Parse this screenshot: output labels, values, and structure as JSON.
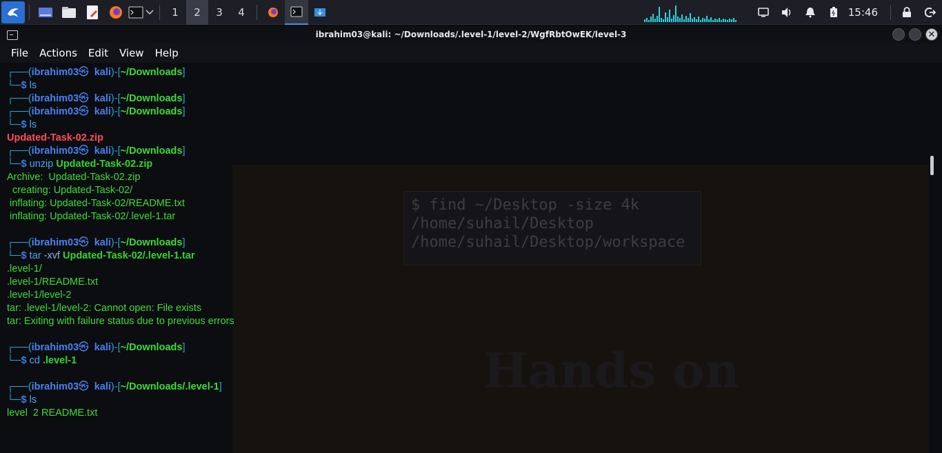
{
  "panel": {
    "workspaces": [
      "1",
      "2",
      "3",
      "4"
    ],
    "active_workspace": "2",
    "clock": "15:46",
    "icons": [
      "kali-menu-icon",
      "desktop-icon",
      "file-manager-icon",
      "text-editor-icon",
      "firefox-icon",
      "terminal-icon",
      "chevron-down-icon"
    ],
    "tray_icons": [
      "screen-icon",
      "volume-icon",
      "bell-icon",
      "battery-icon",
      "lock-icon",
      "logout-icon"
    ]
  },
  "window": {
    "title": "ibrahim03@kali: ~/Downloads/.level-1/level-2/WgfRbtOwEK/level-3",
    "menu": [
      "File",
      "Actions",
      "Edit",
      "View",
      "Help"
    ]
  },
  "prompt": {
    "user": "ibrahim03",
    "host": "kali",
    "skull": "㉿"
  },
  "terminal": {
    "blocks": [
      {
        "dir": "~/Downloads",
        "cmd": "ls",
        "args": [],
        "output": []
      },
      {
        "dir": "~/Downloads",
        "cmd": null,
        "args": [],
        "output": []
      },
      {
        "dir": "~/Downloads",
        "cmd": "ls",
        "args": [],
        "output": [
          {
            "text": "Updated-Task-02.zip",
            "kind": "red"
          }
        ]
      },
      {
        "dir": "~/Downloads",
        "cmd": "unzip",
        "args": [
          {
            "text": "Updated-Task-02.zip",
            "kind": "arg"
          }
        ],
        "output": [
          {
            "text": "Archive:  Updated-Task-02.zip",
            "kind": "out"
          },
          {
            "text": "  creating: Updated-Task-02/",
            "kind": "out"
          },
          {
            "text": " inflating: Updated-Task-02/README.txt",
            "kind": "out"
          },
          {
            "text": " inflating: Updated-Task-02/.level-1.tar",
            "kind": "out"
          },
          {
            "text": "",
            "kind": "out"
          }
        ]
      },
      {
        "dir": "~/Downloads",
        "cmd": "tar",
        "args": [
          {
            "text": "-xvf",
            "kind": "opt"
          },
          {
            "text": "Updated-Task-02/.level-1.tar",
            "kind": "arg"
          }
        ],
        "output": [
          {
            "text": ".level-1/",
            "kind": "out"
          },
          {
            "text": ".level-1/README.txt",
            "kind": "out"
          },
          {
            "text": ".level-1/level-2",
            "kind": "out"
          },
          {
            "text": "tar: .level-1/level-2: Cannot open: File exists",
            "kind": "out"
          },
          {
            "text": "tar: Exiting with failure status due to previous errors",
            "kind": "out"
          },
          {
            "text": "",
            "kind": "out"
          }
        ]
      },
      {
        "dir": "~/Downloads",
        "cmd": "cd",
        "args": [
          {
            "text": ".level-1",
            "kind": "arg"
          }
        ],
        "output": [
          {
            "text": "",
            "kind": "out"
          }
        ]
      },
      {
        "dir": "~/Downloads/.level-1",
        "cmd": "ls",
        "args": [],
        "output": [
          {
            "text": "level  2 README.txt",
            "kind": "out"
          }
        ]
      }
    ]
  },
  "ghost": {
    "code_lines": [
      "$ find ~/Desktop -size 4k",
      "/home/suhail/Desktop",
      "/home/suhail/Desktop/workspace"
    ],
    "heading": "Hands on"
  },
  "colors": {
    "accent": "#2a6fd1",
    "prompt_box": "#2aa9dd",
    "user": "#4b80f0",
    "dir": "#3edc37",
    "error_file": "#ff4d5a",
    "cpu_graph": "#2ad4e0"
  }
}
